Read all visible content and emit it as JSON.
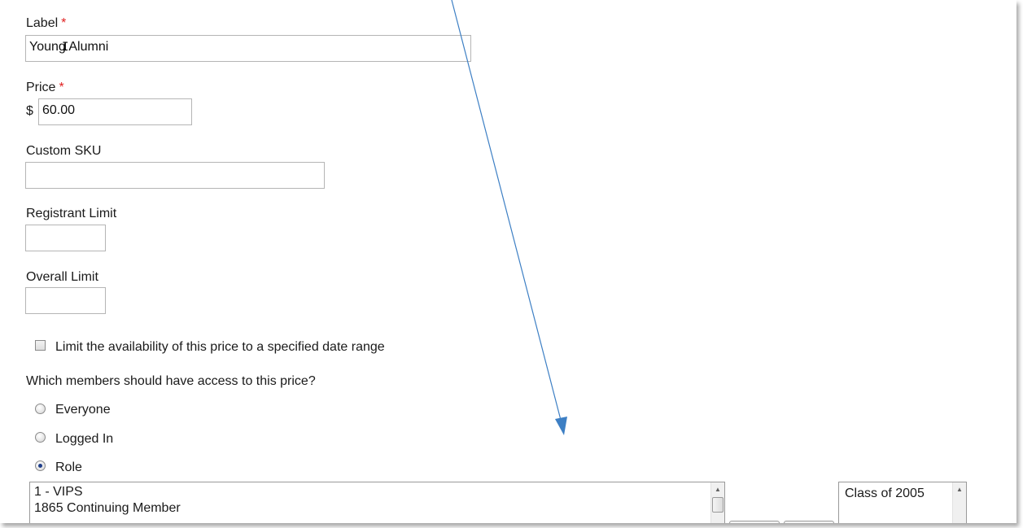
{
  "form": {
    "label_field": {
      "label": "Label",
      "required_mark": "*",
      "value": "Young Alumni"
    },
    "price_field": {
      "label": "Price",
      "required_mark": "*",
      "currency": "$",
      "value": "60.00"
    },
    "sku_field": {
      "label": "Custom SKU",
      "value": ""
    },
    "registrant_limit_field": {
      "label": "Registrant Limit",
      "value": ""
    },
    "overall_limit_field": {
      "label": "Overall Limit",
      "value": ""
    },
    "date_range_checkbox": {
      "label": "Limit the availability of this price to a specified date range",
      "checked": false
    },
    "access": {
      "question": "Which members should have access to this price?",
      "options": [
        {
          "label": "Everyone",
          "selected": false
        },
        {
          "label": "Logged In",
          "selected": false
        },
        {
          "label": "Role",
          "selected": true
        }
      ]
    },
    "roles_available": [
      "1 - VIPS",
      "1865 Continuing Member"
    ],
    "roles_selected": [
      "Class of 2005"
    ]
  },
  "annotation": {
    "arrow_color": "#3d7fc4"
  },
  "icons": {
    "scroll_up": "scroll-up-arrow-icon",
    "cursor": "text-cursor-icon"
  }
}
